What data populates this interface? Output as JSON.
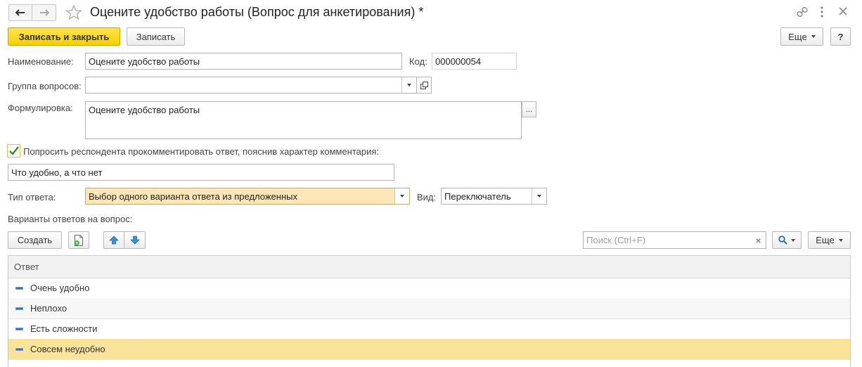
{
  "window": {
    "title": "Оцените удобство работы (Вопрос для анкетирования) *"
  },
  "toolbar": {
    "save_close_label": "Записать и закрыть",
    "save_label": "Записать",
    "more_label": "Еще",
    "help_label": "?"
  },
  "form": {
    "name_label": "Наименование:",
    "name_value": "Оцените удобство работы",
    "code_label": "Код:",
    "code_value": "000000054",
    "group_label": "Группа вопросов:",
    "group_value": "",
    "wording_label": "Формулировка:",
    "wording_value": "Оцените удобство работы",
    "ellipsis_label": "...",
    "comment_checkbox_checked": true,
    "comment_checkbox_label": "Попросить респондента прокомментировать ответ, пояснив характер комментария:",
    "comment_value": "Что удобно, а что нет",
    "answer_type_label": "Тип ответа:",
    "answer_type_value": "Выбор одного варианта ответа из предложенных",
    "view_label": "Вид:",
    "view_value": "Переключатель",
    "variants_label": "Варианты ответов на вопрос:"
  },
  "variants_toolbar": {
    "create_label": "Создать",
    "search_placeholder": "Поиск (Ctrl+F)",
    "clear_label": "×",
    "more_label": "Еще"
  },
  "table": {
    "column_header": "Ответ",
    "rows": [
      {
        "label": "Очень удобно"
      },
      {
        "label": "Неплохо"
      },
      {
        "label": "Есть сложности"
      },
      {
        "label": "Совсем неудобно"
      }
    ],
    "selected_index": 3
  },
  "colors": {
    "accent_yellow": "#f5cf00",
    "highlight_field": "#fde6b8",
    "selected_row": "#fbe49a",
    "alt_row": "#f7f7f7",
    "check_green": "#2e8b2e"
  }
}
